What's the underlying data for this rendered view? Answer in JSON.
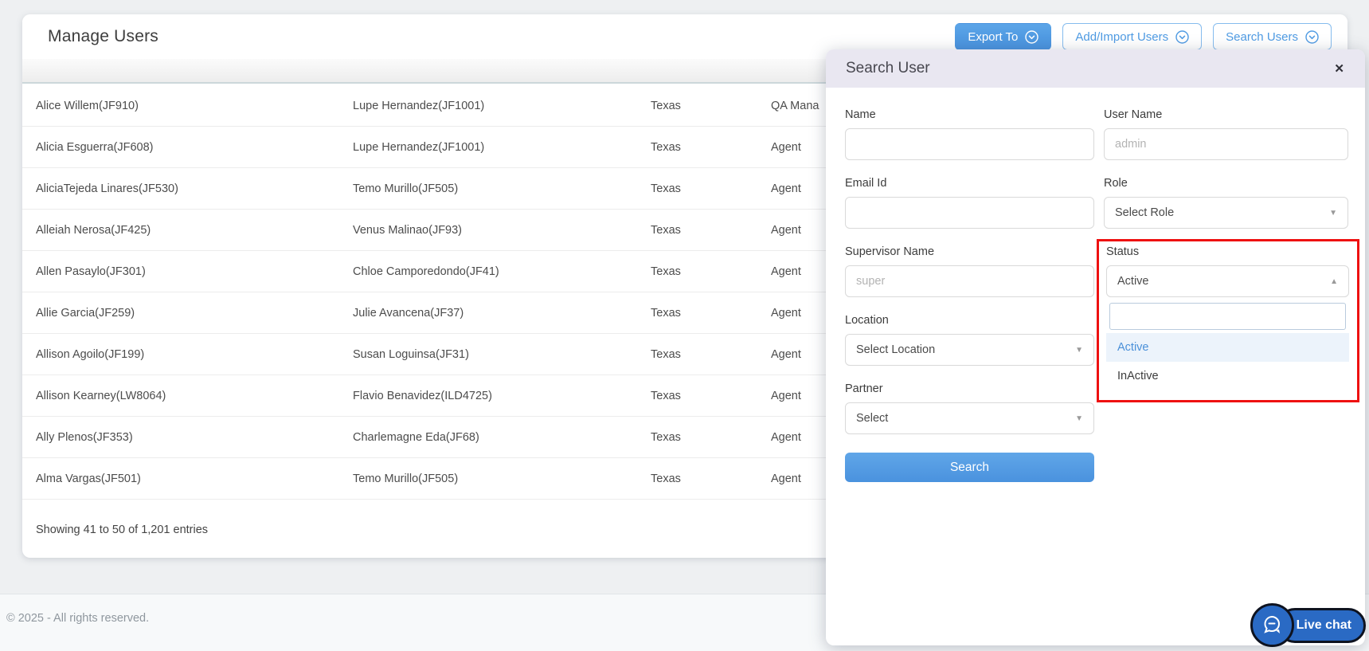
{
  "header": {
    "title": "Manage Users",
    "buttons": [
      {
        "label": "Export To",
        "style": "primary"
      },
      {
        "label": "Add/Import Users",
        "style": "outline"
      },
      {
        "label": "Search Users",
        "style": "outline"
      }
    ]
  },
  "table": {
    "rows": [
      {
        "name": "Alice Willem(JF910)",
        "supervisor": "Lupe Hernandez(JF1001)",
        "location": "Texas",
        "role": "QA Mana"
      },
      {
        "name": "Alicia Esguerra(JF608)",
        "supervisor": "Lupe Hernandez(JF1001)",
        "location": "Texas",
        "role": "Agent"
      },
      {
        "name": "AliciaTejeda Linares(JF530)",
        "supervisor": "Temo Murillo(JF505)",
        "location": "Texas",
        "role": "Agent"
      },
      {
        "name": "Alleiah Nerosa(JF425)",
        "supervisor": "Venus Malinao(JF93)",
        "location": "Texas",
        "role": "Agent"
      },
      {
        "name": "Allen Pasaylo(JF301)",
        "supervisor": "Chloe Camporedondo(JF41)",
        "location": "Texas",
        "role": "Agent"
      },
      {
        "name": "Allie Garcia(JF259)",
        "supervisor": "Julie Avancena(JF37)",
        "location": "Texas",
        "role": "Agent"
      },
      {
        "name": "Allison Agoilo(JF199)",
        "supervisor": "Susan Loguinsa(JF31)",
        "location": "Texas",
        "role": "Agent"
      },
      {
        "name": "Allison Kearney(LW8064)",
        "supervisor": "Flavio Benavidez(ILD4725)",
        "location": "Texas",
        "role": "Agent"
      },
      {
        "name": "Ally Plenos(JF353)",
        "supervisor": "Charlemagne Eda(JF68)",
        "location": "Texas",
        "role": "Agent"
      },
      {
        "name": "Alma Vargas(JF501)",
        "supervisor": "Temo Murillo(JF505)",
        "location": "Texas",
        "role": "Agent"
      }
    ],
    "summary": "Showing 41 to 50 of 1,201 entries"
  },
  "panel": {
    "title": "Search User",
    "close_icon": "✕",
    "fields": {
      "name": {
        "label": "Name",
        "value": ""
      },
      "user_name": {
        "label": "User Name",
        "placeholder": "admin"
      },
      "email": {
        "label": "Email Id",
        "value": ""
      },
      "role": {
        "label": "Role",
        "value": "Select Role"
      },
      "supervisor": {
        "label": "Supervisor Name",
        "placeholder": "super"
      },
      "status": {
        "label": "Status",
        "value": "Active",
        "filter_value": "",
        "options": [
          "Active",
          "InActive"
        ],
        "selected": "Active"
      },
      "location": {
        "label": "Location",
        "value": "Select Location"
      },
      "partner": {
        "label": "Partner",
        "value": "Select"
      }
    },
    "search_button": "Search"
  },
  "footer": {
    "copyright": "© 2025 - All rights reserved."
  },
  "live_chat": {
    "label": "Live chat"
  },
  "icons": {
    "caret_down": "▼",
    "caret_up": "▲"
  },
  "colors": {
    "accent_blue": "#4f9be3",
    "annotation_red": "#ee1111",
    "panel_header": "#e9e7f1",
    "option_highlight": "#ecf3fb",
    "live_chat_blue": "#2a6ac4"
  }
}
